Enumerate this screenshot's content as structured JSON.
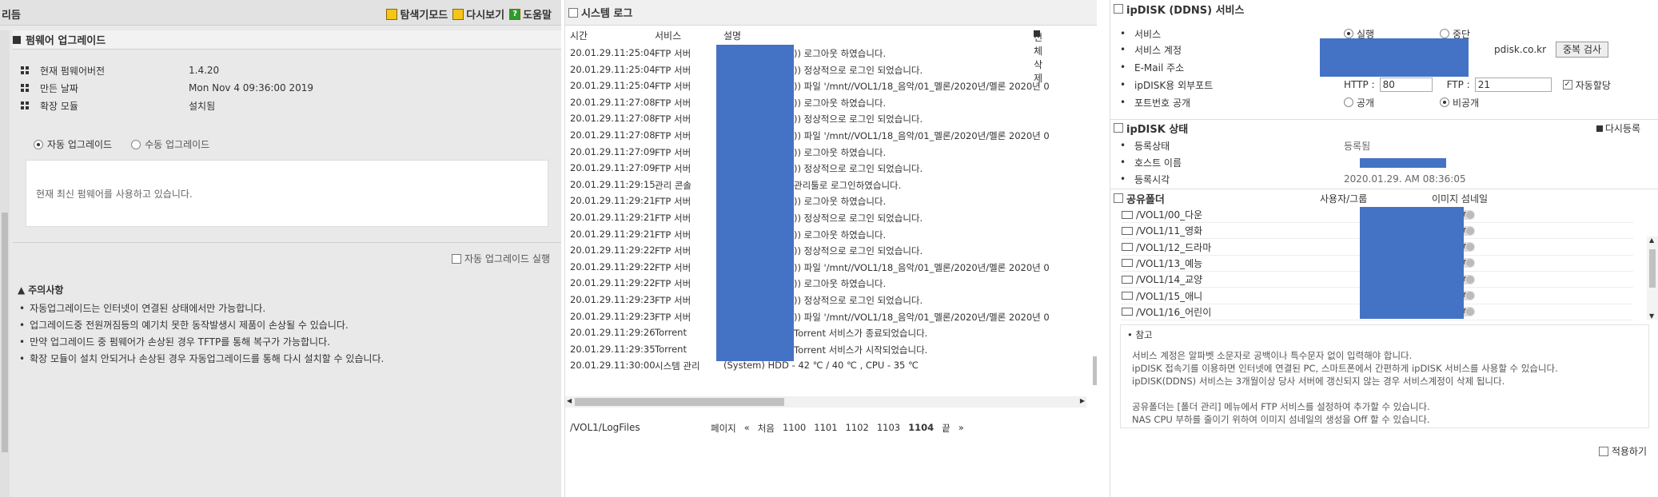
{
  "firmware": {
    "panel_title": "리듬",
    "tools": [
      "탐색기모드",
      "다시보기",
      "도움말"
    ],
    "section_title": "펌웨어 업그레이드",
    "info": [
      {
        "label": "현재 펌웨어버전",
        "value": "1.4.20"
      },
      {
        "label": "만든 날짜",
        "value": "Mon Nov 4 09:36:00 2019"
      },
      {
        "label": "확장 모듈",
        "value": "설치됨"
      }
    ],
    "auto_label": "자동 업그레이드",
    "manual_label": "수동 업그레이드",
    "message": "현재 최신 펌웨어를 사용하고 있습니다.",
    "run_label": "자동 업그레이드 실행",
    "caution_title": "주의사항",
    "caution_items": [
      "자동업그레이드는 인터넷이 연결된 상태에서만 가능합니다.",
      "업그레이드중 전원꺼짐등의 예기치 못한 동작발생시 제품이 손상될 수 있습니다.",
      "만약 업그레이드 중 펌웨어가 손상된 경우 TFTP를 통해 복구가 가능합니다.",
      "확장 모듈이 설치 안되거나 손상된 경우 자동업그레이드를 통해 다시 설치할 수 있습니다."
    ]
  },
  "syslog": {
    "title": "시스템 로그",
    "col_time": "시간",
    "col_service": "서비스",
    "col_desc": "설명",
    "delete_all": "전체삭제",
    "rows": [
      {
        "time": "20.01.29.11:25:04",
        "service": "FTP 서버",
        "desc": ")) 로그아웃 하였습니다."
      },
      {
        "time": "20.01.29.11:25:04",
        "service": "FTP 서버",
        "desc": ")) 정상적으로 로그인 되었습니다."
      },
      {
        "time": "20.01.29.11:25:04",
        "service": "FTP 서버",
        "desc": ")) 파일 '/mnt//VOL1/18_음악/01_멜론/2020년/멜론 2020년 0"
      },
      {
        "time": "20.01.29.11:27:08",
        "service": "FTP 서버",
        "desc": ")) 로그아웃 하였습니다."
      },
      {
        "time": "20.01.29.11:27:08",
        "service": "FTP 서버",
        "desc": ")) 정상적으로 로그인 되었습니다."
      },
      {
        "time": "20.01.29.11:27:08",
        "service": "FTP 서버",
        "desc": ")) 파일 '/mnt//VOL1/18_음악/01_멜론/2020년/멜론 2020년 0"
      },
      {
        "time": "20.01.29.11:27:09",
        "service": "FTP 서버",
        "desc": ")) 로그아웃 하였습니다."
      },
      {
        "time": "20.01.29.11:27:09",
        "service": "FTP 서버",
        "desc": ")) 정상적으로 로그인 되었습니다."
      },
      {
        "time": "20.01.29.11:29:15",
        "service": "관리 콘솔",
        "desc": "관리툴로 로그인하였습니다."
      },
      {
        "time": "20.01.29.11:29:21",
        "service": "FTP 서버",
        "desc": ")) 로그아웃 하였습니다."
      },
      {
        "time": "20.01.29.11:29:21",
        "service": "FTP 서버",
        "desc": ")) 정상적으로 로그인 되었습니다."
      },
      {
        "time": "20.01.29.11:29:21",
        "service": "FTP 서버",
        "desc": ")) 로그아웃 하였습니다."
      },
      {
        "time": "20.01.29.11:29:22",
        "service": "FTP 서버",
        "desc": ")) 정상적으로 로그인 되었습니다."
      },
      {
        "time": "20.01.29.11:29:22",
        "service": "FTP 서버",
        "desc": ")) 파일 '/mnt//VOL1/18_음악/01_멜론/2020년/멜론 2020년 0"
      },
      {
        "time": "20.01.29.11:29:22",
        "service": "FTP 서버",
        "desc": ")) 로그아웃 하였습니다."
      },
      {
        "time": "20.01.29.11:29:23",
        "service": "FTP 서버",
        "desc": ")) 정상적으로 로그인 되었습니다."
      },
      {
        "time": "20.01.29.11:29:23",
        "service": "FTP 서버",
        "desc": ")) 파일 '/mnt//VOL1/18_음악/01_멜론/2020년/멜론 2020년 0"
      },
      {
        "time": "20.01.29.11:29:26",
        "service": "Torrent",
        "desc": "Torrent 서비스가 종료되었습니다."
      },
      {
        "time": "20.01.29.11:29:35",
        "service": "Torrent",
        "desc": "Torrent 서비스가 시작되었습니다."
      },
      {
        "time": "20.01.29.11:30:00",
        "service": "시스템 관리",
        "desc": "(System) HDD - 42 ℃ / 40 ℃ , CPU - 35 ℃"
      }
    ],
    "path": "/VOL1/LogFiles",
    "page_label": "페이지",
    "first": "처음",
    "pages": [
      "1100",
      "1101",
      "1102",
      "1103",
      "1104"
    ],
    "last": "끝"
  },
  "ipdisk": {
    "title": "ipDISK (DDNS) 서비스",
    "service_label": "서비스",
    "run": "실행",
    "stop": "중단",
    "account_label": "서비스 계정",
    "domain_suffix": "pdisk.co.kr",
    "dup_check": "중복 검사",
    "email_label": "E-Mail 주소",
    "external_port_label": "ipDISK용 외부포트",
    "http_label": "HTTP :",
    "http_value": "80",
    "ftp_label": "FTP :",
    "ftp_value": "21",
    "auto_assign": "자동할당",
    "port_public_label": "포트번호 공개",
    "public": "공개",
    "private": "비공개",
    "status_title": "ipDISK 상태",
    "re_register": "다시등록",
    "reg_status_label": "등록상태",
    "reg_status_value": "등록됨",
    "host_label": "호스트 이름",
    "reg_time_label": "등록시각",
    "reg_time_value": "2020.01.29. AM 08:36:05",
    "shared_title": "공유폴더",
    "user_group": "사용자/그룹",
    "thumbnail": "이미지 섬네일",
    "folders": [
      "/VOL1/00_다운",
      "/VOL1/11_영화",
      "/VOL1/12_드라마",
      "/VOL1/13_예능",
      "/VOL1/14_교양",
      "/VOL1/15_애니",
      "/VOL1/16_어린이"
    ],
    "toggle_text": "off",
    "note_title": "참고",
    "notes": [
      "서비스 계정은 알파벳 소문자로 공백이나 특수문자 없이 입력해야 합니다.",
      "ipDISK 접속기를 이용하면 인터넷에 연결된 PC, 스마트폰에서 간편하게 ipDISK 서비스를 사용할 수 있습니다.",
      "ipDISK(DDNS) 서비스는 3개월이상 당사 서버에 갱신되지 않는 경우 서비스계정이 삭제 됩니다.",
      "",
      "공유폴더는 [폴더 관리] 메뉴에서 FTP 서비스를 설정하여 추가할 수 있습니다.",
      "NAS CPU 부하를 줄이기 위하여 이미지 섬네일의 생성을 Off 할 수 있습니다."
    ],
    "apply": "적용하기"
  }
}
